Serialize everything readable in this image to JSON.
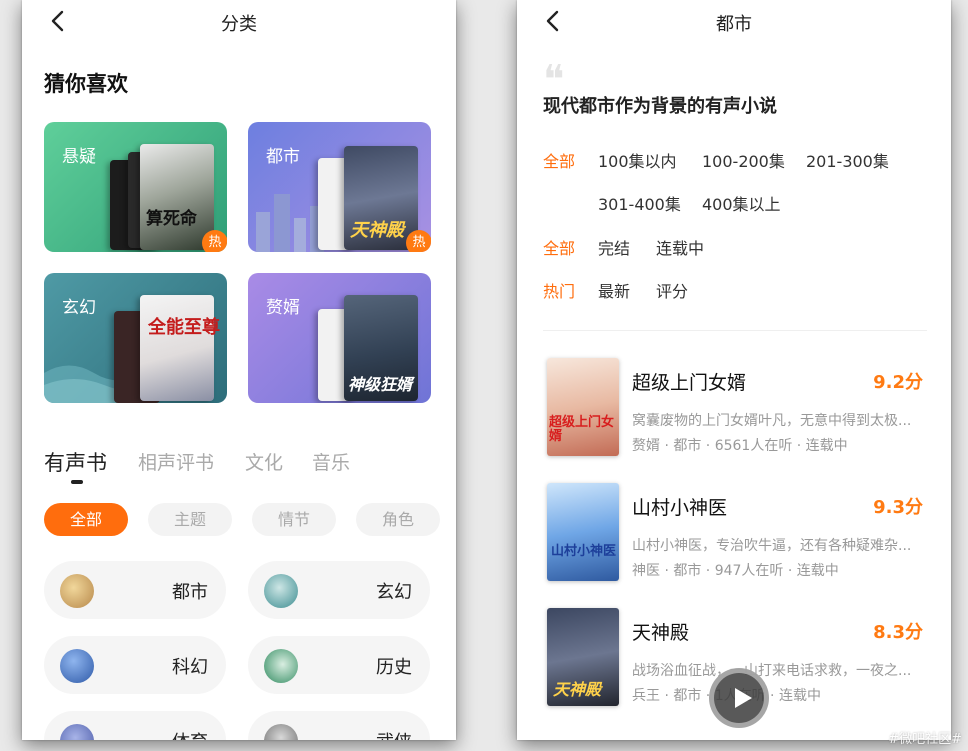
{
  "left": {
    "title": "分类",
    "section_title": "猜你喜欢",
    "cards": [
      {
        "label": "悬疑",
        "badge": "热",
        "cover_text": "算死命"
      },
      {
        "label": "都市",
        "badge": "热",
        "cover_text": "天神殿"
      },
      {
        "label": "玄幻",
        "cover_text": "全能至尊"
      },
      {
        "label": "赘婿",
        "cover_text": "神级狂婿"
      }
    ],
    "tabs": [
      "有声书",
      "相声评书",
      "文化",
      "音乐"
    ],
    "filters": [
      "全部",
      "主题",
      "情节",
      "角色"
    ],
    "genres": [
      {
        "name": "都市",
        "icon": "city-icon"
      },
      {
        "name": "玄幻",
        "icon": "fantasy-icon"
      },
      {
        "name": "科幻",
        "icon": "planet-icon"
      },
      {
        "name": "历史",
        "icon": "history-icon"
      },
      {
        "name": "体育",
        "icon": "sports-icon"
      },
      {
        "name": "武侠",
        "icon": "martial-arts-icon"
      }
    ]
  },
  "right": {
    "title": "都市",
    "subtitle": "现代都市作为背景的有声小说",
    "episode_filters": [
      "全部",
      "100集以内",
      "100-200集",
      "201-300集",
      "301-400集",
      "400集以上"
    ],
    "status_filters": [
      "全部",
      "完结",
      "连载中"
    ],
    "sort_filters": [
      "热门",
      "最新",
      "评分"
    ],
    "items": [
      {
        "name": "超级上门女婿",
        "score": "9.2分",
        "desc": "窝囊废物的上门女婿叶凡，无意中得到太极...",
        "meta": "赘婿 · 都市 · 6561人在听 · 连载中",
        "cover_text": "超级上门女婿"
      },
      {
        "name": "山村小神医",
        "score": "9.3分",
        "desc": "山村小神医，专治吹牛逼，还有各种疑难杂...",
        "meta": "神医 · 都市 · 947人在听 · 连载中",
        "cover_text": "山村小神医"
      },
      {
        "name": "天神殿",
        "score": "8.3分",
        "desc": "战场浴血征战，一山打来电话求救，一夜之...",
        "meta": "兵王 · 都市 · 1人在听 · 连载中",
        "cover_text": "天神殿"
      }
    ]
  },
  "watermark": "#微吧社区#",
  "colors": {
    "accent": "#ff6d0d",
    "score": "#ff7a12"
  }
}
